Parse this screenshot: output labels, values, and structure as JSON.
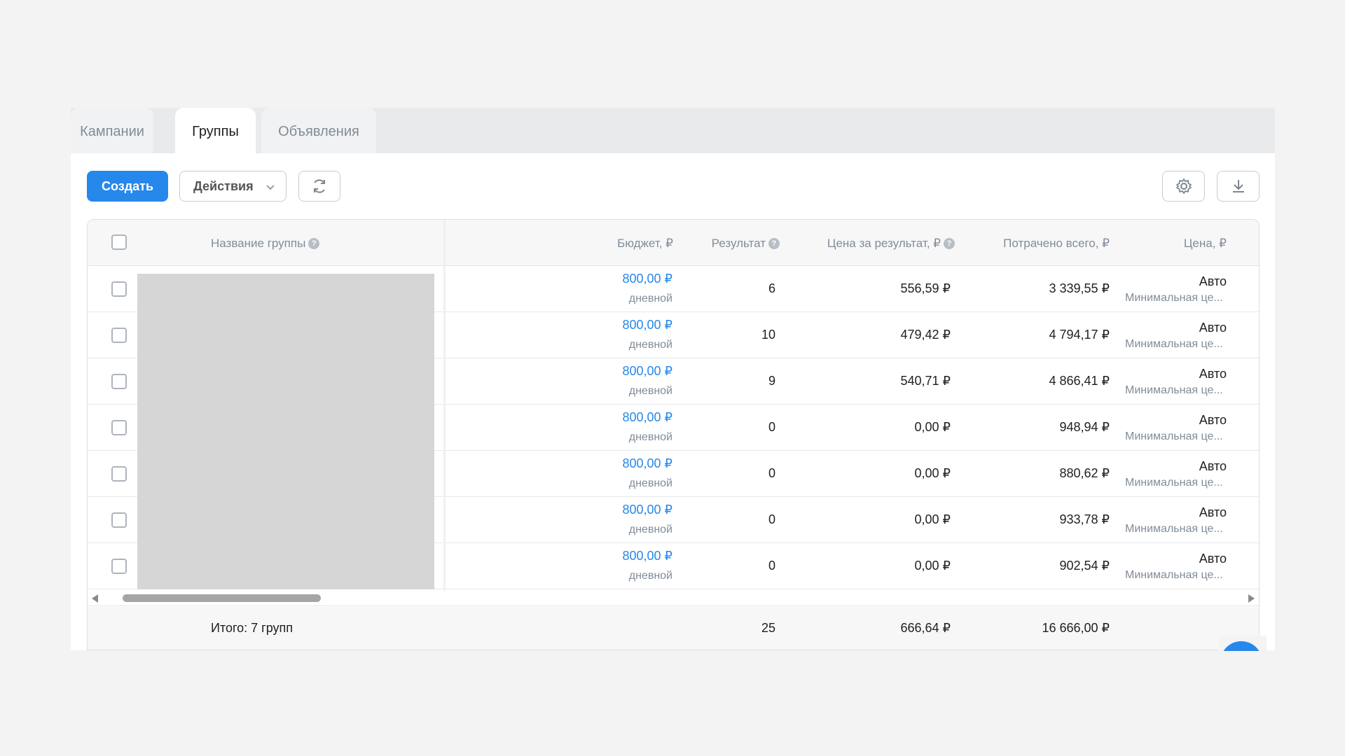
{
  "tabs": [
    {
      "label": "Кампании",
      "active": false
    },
    {
      "label": "Группы",
      "active": true
    },
    {
      "label": "Объявления",
      "active": false
    }
  ],
  "toolbar": {
    "create_label": "Создать",
    "actions_label": "Действия",
    "refresh_icon": "refresh-icon",
    "settings_icon": "gear-icon",
    "download_icon": "download-icon"
  },
  "table": {
    "headers": {
      "name": "Название группы",
      "budget": "Бюджет, ₽",
      "result": "Результат",
      "cost_per_result": "Цена за результат, ₽",
      "spent": "Потрачено всего, ₽",
      "price": "Цена, ₽"
    },
    "rows": [
      {
        "budget": "800,00 ₽",
        "budget_type": "дневной",
        "result": "6",
        "cost_per_result": "556,59 ₽",
        "spent": "3 339,55 ₽",
        "price": "Авто",
        "price_sub": "Минимальная це..."
      },
      {
        "budget": "800,00 ₽",
        "budget_type": "дневной",
        "result": "10",
        "cost_per_result": "479,42 ₽",
        "spent": "4 794,17 ₽",
        "price": "Авто",
        "price_sub": "Минимальная це..."
      },
      {
        "budget": "800,00 ₽",
        "budget_type": "дневной",
        "result": "9",
        "cost_per_result": "540,71 ₽",
        "spent": "4 866,41 ₽",
        "price": "Авто",
        "price_sub": "Минимальная це..."
      },
      {
        "budget": "800,00 ₽",
        "budget_type": "дневной",
        "result": "0",
        "cost_per_result": "0,00 ₽",
        "spent": "948,94 ₽",
        "price": "Авто",
        "price_sub": "Минимальная це..."
      },
      {
        "budget": "800,00 ₽",
        "budget_type": "дневной",
        "result": "0",
        "cost_per_result": "0,00 ₽",
        "spent": "880,62 ₽",
        "price": "Авто",
        "price_sub": "Минимальная це..."
      },
      {
        "budget": "800,00 ₽",
        "budget_type": "дневной",
        "result": "0",
        "cost_per_result": "0,00 ₽",
        "spent": "933,78 ₽",
        "price": "Авто",
        "price_sub": "Минимальная це..."
      },
      {
        "budget": "800,00 ₽",
        "budget_type": "дневной",
        "result": "0",
        "cost_per_result": "0,00 ₽",
        "spent": "902,54 ₽",
        "price": "Авто",
        "price_sub": "Минимальная це..."
      }
    ],
    "footer": {
      "total_label": "Итого: 7 групп",
      "result": "25",
      "cost_per_result": "666,64 ₽",
      "spent": "16 666,00 ₽"
    }
  },
  "colors": {
    "accent": "#2688eb",
    "muted_text": "#818c99"
  }
}
